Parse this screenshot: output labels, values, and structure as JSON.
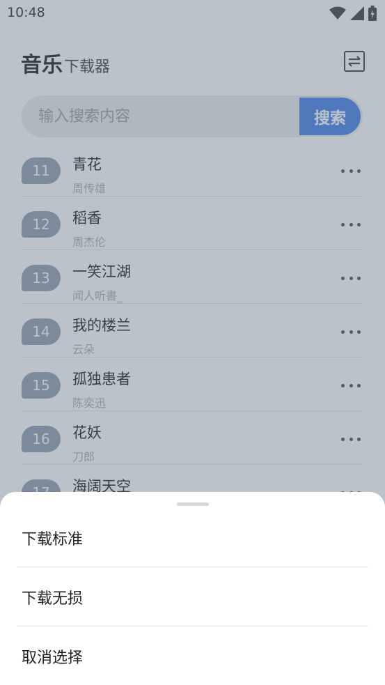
{
  "status_bar": {
    "time": "10:48"
  },
  "header": {
    "title_main": "音乐",
    "title_sub": "下载器"
  },
  "search": {
    "placeholder": "输入搜索内容",
    "value": "",
    "button_label": "搜索"
  },
  "songs": [
    {
      "num": "11",
      "title": "青花",
      "artist": "周传雄"
    },
    {
      "num": "12",
      "title": "稻香",
      "artist": "周杰伦"
    },
    {
      "num": "13",
      "title": "一笑江湖",
      "artist": "闻人听書_"
    },
    {
      "num": "14",
      "title": "我的楼兰",
      "artist": "云朵"
    },
    {
      "num": "15",
      "title": "孤独患者",
      "artist": "陈奕迅"
    },
    {
      "num": "16",
      "title": "花妖",
      "artist": "刀郎"
    },
    {
      "num": "17",
      "title": "海阔天空",
      "artist": ""
    }
  ],
  "sheet": {
    "options": [
      {
        "label": "下载标准"
      },
      {
        "label": "下载无损"
      },
      {
        "label": "取消选择"
      }
    ]
  },
  "colors": {
    "accent": "#3d7bea",
    "badge": "#8d99ad"
  },
  "icons": {
    "menu": "swap-menu-icon",
    "more": "more-icon",
    "wifi": "wifi-icon",
    "signal": "signal-icon",
    "battery": "battery-icon"
  }
}
